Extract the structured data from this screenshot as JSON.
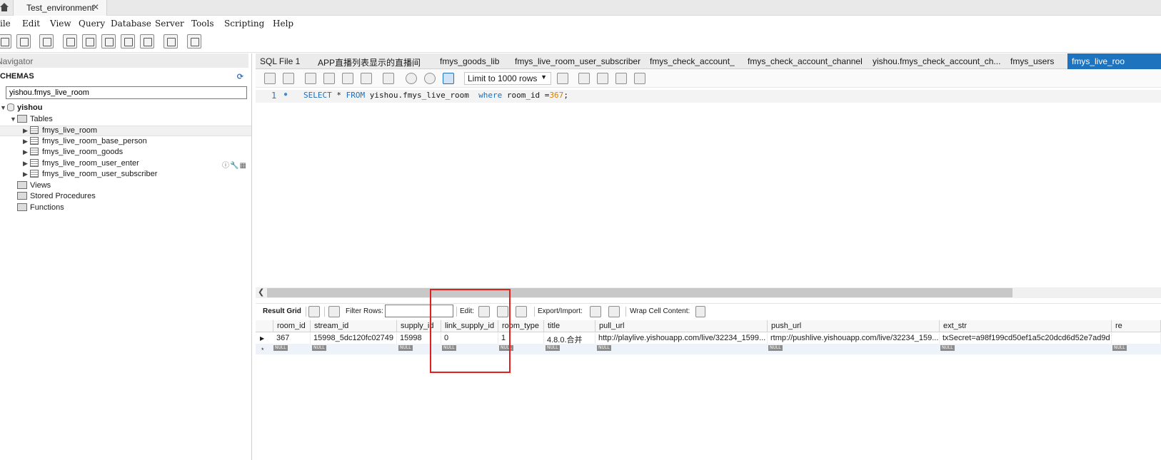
{
  "connection_tab": {
    "label": "Test_environment",
    "close": "✕"
  },
  "menu": [
    "ile",
    "Edit",
    "View",
    "Query",
    "Database",
    "Server",
    "Tools",
    "Scripting",
    "Help"
  ],
  "navigator": {
    "header": "Navigator",
    "schemas_label": "CHEMAS",
    "search_value": "yishou.fmys_live_room",
    "schema": "yishou",
    "tables_label": "Tables",
    "tables": [
      "fmys_live_room",
      "fmys_live_room_base_person",
      "fmys_live_room_goods",
      "fmys_live_room_user_enter",
      "fmys_live_room_user_subscriber"
    ],
    "views_label": "Views",
    "procedures_label": "Stored Procedures",
    "functions_label": "Functions"
  },
  "query_tabs": [
    "SQL File 1",
    "APP直播列表显示的直播间",
    "fmys_goods_lib",
    "fmys_live_room_user_subscriber",
    "fmys_check_account_",
    "fmys_check_account_channel",
    "yishou.fmys_check_account_ch...",
    "fmys_users",
    "fmys_live_roo"
  ],
  "editor": {
    "limit_label": "Limit to 1000 rows",
    "line_number": "1",
    "sql": {
      "select": "SELECT",
      "star": " * ",
      "from": "FROM",
      "table": " yishou.fmys_live_room  ",
      "where": "where",
      "cond": " room_id =",
      "value": "367",
      "end": ";"
    }
  },
  "result_toolbar": {
    "result_grid": "Result Grid",
    "filter_rows": "Filter Rows:",
    "edit": "Edit:",
    "export_import": "Export/Import:",
    "wrap_cell": "Wrap Cell Content:"
  },
  "grid": {
    "columns": [
      "room_id",
      "stream_id",
      "supply_id",
      "link_supply_id",
      "room_type",
      "title",
      "pull_url",
      "push_url",
      "ext_str",
      "re"
    ],
    "row": [
      "367",
      "15998_5dc120fc02749",
      "15998",
      "0",
      "1",
      "4.8.0.合并",
      "http://playlive.yishouapp.com/live/32234_1599...",
      "rtmp://pushlive.yishouapp.com/live/32234_159...",
      "txSecret=a98f199cd50ef1a5c20dcd6d52e7ad9d",
      ""
    ],
    "null_label": "NULL",
    "new_row_marker": "*"
  },
  "colors": {
    "accent": "#1e73be",
    "keyword": "#1e6fb8",
    "number": "#d58000",
    "annotation": "#e0201f"
  }
}
